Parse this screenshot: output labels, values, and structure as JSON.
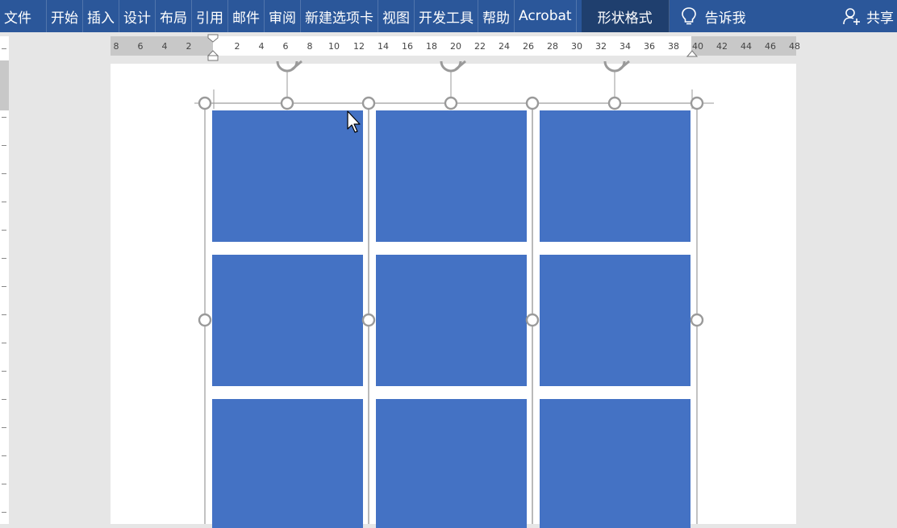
{
  "ribbon": {
    "tabs": [
      "文件",
      "开始",
      "插入",
      "设计",
      "布局",
      "引用",
      "邮件",
      "审阅",
      "新建选项卡",
      "视图",
      "开发工具",
      "帮助",
      "Acrobat"
    ],
    "context_tab": "形状格式",
    "tell_me": "告诉我",
    "share": "共享"
  },
  "ruler": {
    "left_ticks": [
      "8",
      "6",
      "4",
      "2"
    ],
    "right_ticks": [
      "2",
      "4",
      "6",
      "8",
      "10",
      "12",
      "14",
      "16",
      "18",
      "20",
      "22",
      "24",
      "26",
      "28",
      "30",
      "32",
      "34",
      "36",
      "38",
      "40",
      "42",
      "44",
      "46",
      "48"
    ]
  },
  "colors": {
    "ribbon": "#2b579a",
    "context_tab": "#1f3f6e",
    "shape_fill": "#4472c4",
    "handle": "#9a9a9a"
  },
  "icons": {
    "tell_me": "lightbulb-icon",
    "share": "person-add-icon",
    "cursor": "mouse-pointer-icon"
  }
}
